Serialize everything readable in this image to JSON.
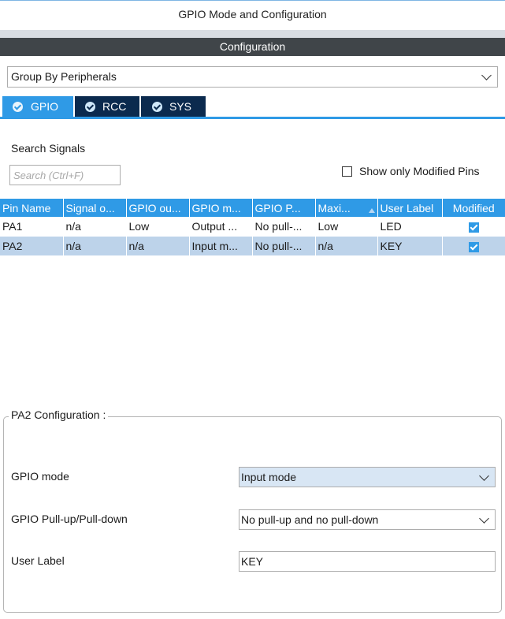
{
  "header": {
    "title": "GPIO Mode and Configuration"
  },
  "config_bar": {
    "label": "Configuration"
  },
  "group_select": {
    "value": "Group By Peripherals"
  },
  "tabs": [
    {
      "label": "GPIO",
      "active": true
    },
    {
      "label": "RCC",
      "active": false
    },
    {
      "label": "SYS",
      "active": false
    }
  ],
  "search": {
    "heading": "Search Signals",
    "placeholder": "Search (Ctrl+F)",
    "show_modified_label": "Show only Modified Pins",
    "show_modified_checked": false
  },
  "table": {
    "columns": [
      "Pin Name",
      "Signal o...",
      "GPIO ou...",
      "GPIO m...",
      "GPIO P...",
      "Maxi...",
      "User Label",
      "Modified"
    ],
    "rows": [
      {
        "cells": [
          "PA1",
          "n/a",
          "Low",
          "Output ...",
          "No pull-...",
          "Low",
          "LED"
        ],
        "modified": true,
        "selected": false
      },
      {
        "cells": [
          "PA2",
          "n/a",
          "n/a",
          "Input m...",
          "No pull-...",
          "n/a",
          "KEY"
        ],
        "modified": true,
        "selected": true
      }
    ]
  },
  "pin_config": {
    "legend": "PA2 Configuration :",
    "gpio_mode": {
      "label": "GPIO mode",
      "value": "Input mode"
    },
    "pull": {
      "label": "GPIO Pull-up/Pull-down",
      "value": "No pull-up and no pull-down"
    },
    "user_label": {
      "label": "User Label",
      "value": "KEY"
    }
  },
  "colors": {
    "accent": "#2f9ae6",
    "tab_inactive": "#0b2a4e",
    "header_bar": "#404549",
    "selected_row": "#bdd3ea"
  }
}
